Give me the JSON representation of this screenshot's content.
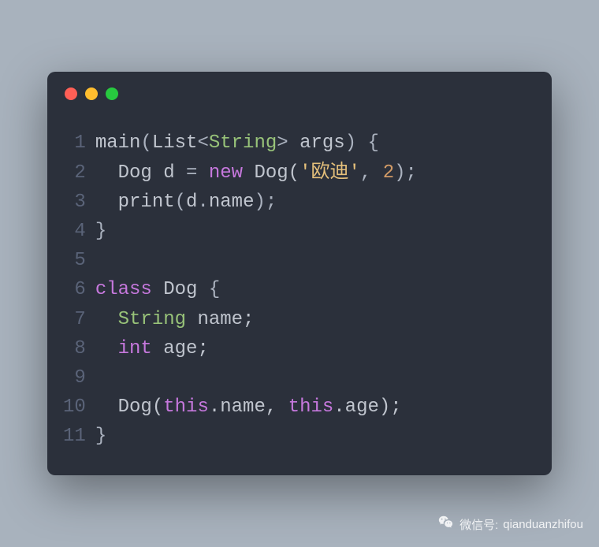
{
  "window": {
    "dots": [
      "red",
      "yellow",
      "green"
    ]
  },
  "code": {
    "line_count": 11,
    "lines": [
      [
        {
          "t": "main",
          "c": "c-default"
        },
        {
          "t": "(",
          "c": "c-punct"
        },
        {
          "t": "List",
          "c": "c-default"
        },
        {
          "t": "<",
          "c": "c-punct"
        },
        {
          "t": "String",
          "c": "c-green"
        },
        {
          "t": ">",
          "c": "c-punct"
        },
        {
          "t": " args",
          "c": "c-default"
        },
        {
          "t": ") {",
          "c": "c-punct"
        }
      ],
      [
        {
          "t": "  Dog d ",
          "c": "c-default"
        },
        {
          "t": "=",
          "c": "c-punct"
        },
        {
          "t": " ",
          "c": "c-default"
        },
        {
          "t": "new",
          "c": "c-keyword"
        },
        {
          "t": " Dog(",
          "c": "c-default"
        },
        {
          "t": "'欧迪'",
          "c": "c-string"
        },
        {
          "t": ", ",
          "c": "c-punct"
        },
        {
          "t": "2",
          "c": "c-number"
        },
        {
          "t": ");",
          "c": "c-punct"
        }
      ],
      [
        {
          "t": "  print",
          "c": "c-default"
        },
        {
          "t": "(",
          "c": "c-punct"
        },
        {
          "t": "d",
          "c": "c-default"
        },
        {
          "t": ".",
          "c": "c-punct"
        },
        {
          "t": "name",
          "c": "c-default"
        },
        {
          "t": ");",
          "c": "c-punct"
        }
      ],
      [
        {
          "t": "}",
          "c": "c-punct"
        }
      ],
      [
        {
          "t": "",
          "c": "c-default"
        }
      ],
      [
        {
          "t": "class",
          "c": "c-keyword"
        },
        {
          "t": " Dog ",
          "c": "c-default"
        },
        {
          "t": "{",
          "c": "c-punct"
        }
      ],
      [
        {
          "t": "  ",
          "c": "c-default"
        },
        {
          "t": "String",
          "c": "c-green"
        },
        {
          "t": " name;",
          "c": "c-default"
        }
      ],
      [
        {
          "t": "  ",
          "c": "c-default"
        },
        {
          "t": "int",
          "c": "c-keyword"
        },
        {
          "t": " age;",
          "c": "c-default"
        }
      ],
      [
        {
          "t": "",
          "c": "c-default"
        }
      ],
      [
        {
          "t": "  Dog(",
          "c": "c-default"
        },
        {
          "t": "this",
          "c": "c-keyword"
        },
        {
          "t": ".name, ",
          "c": "c-default"
        },
        {
          "t": "this",
          "c": "c-keyword"
        },
        {
          "t": ".age);",
          "c": "c-default"
        }
      ],
      [
        {
          "t": "}",
          "c": "c-punct"
        }
      ]
    ]
  },
  "watermark": {
    "label": "微信号:",
    "value": "qianduanzhifou"
  }
}
